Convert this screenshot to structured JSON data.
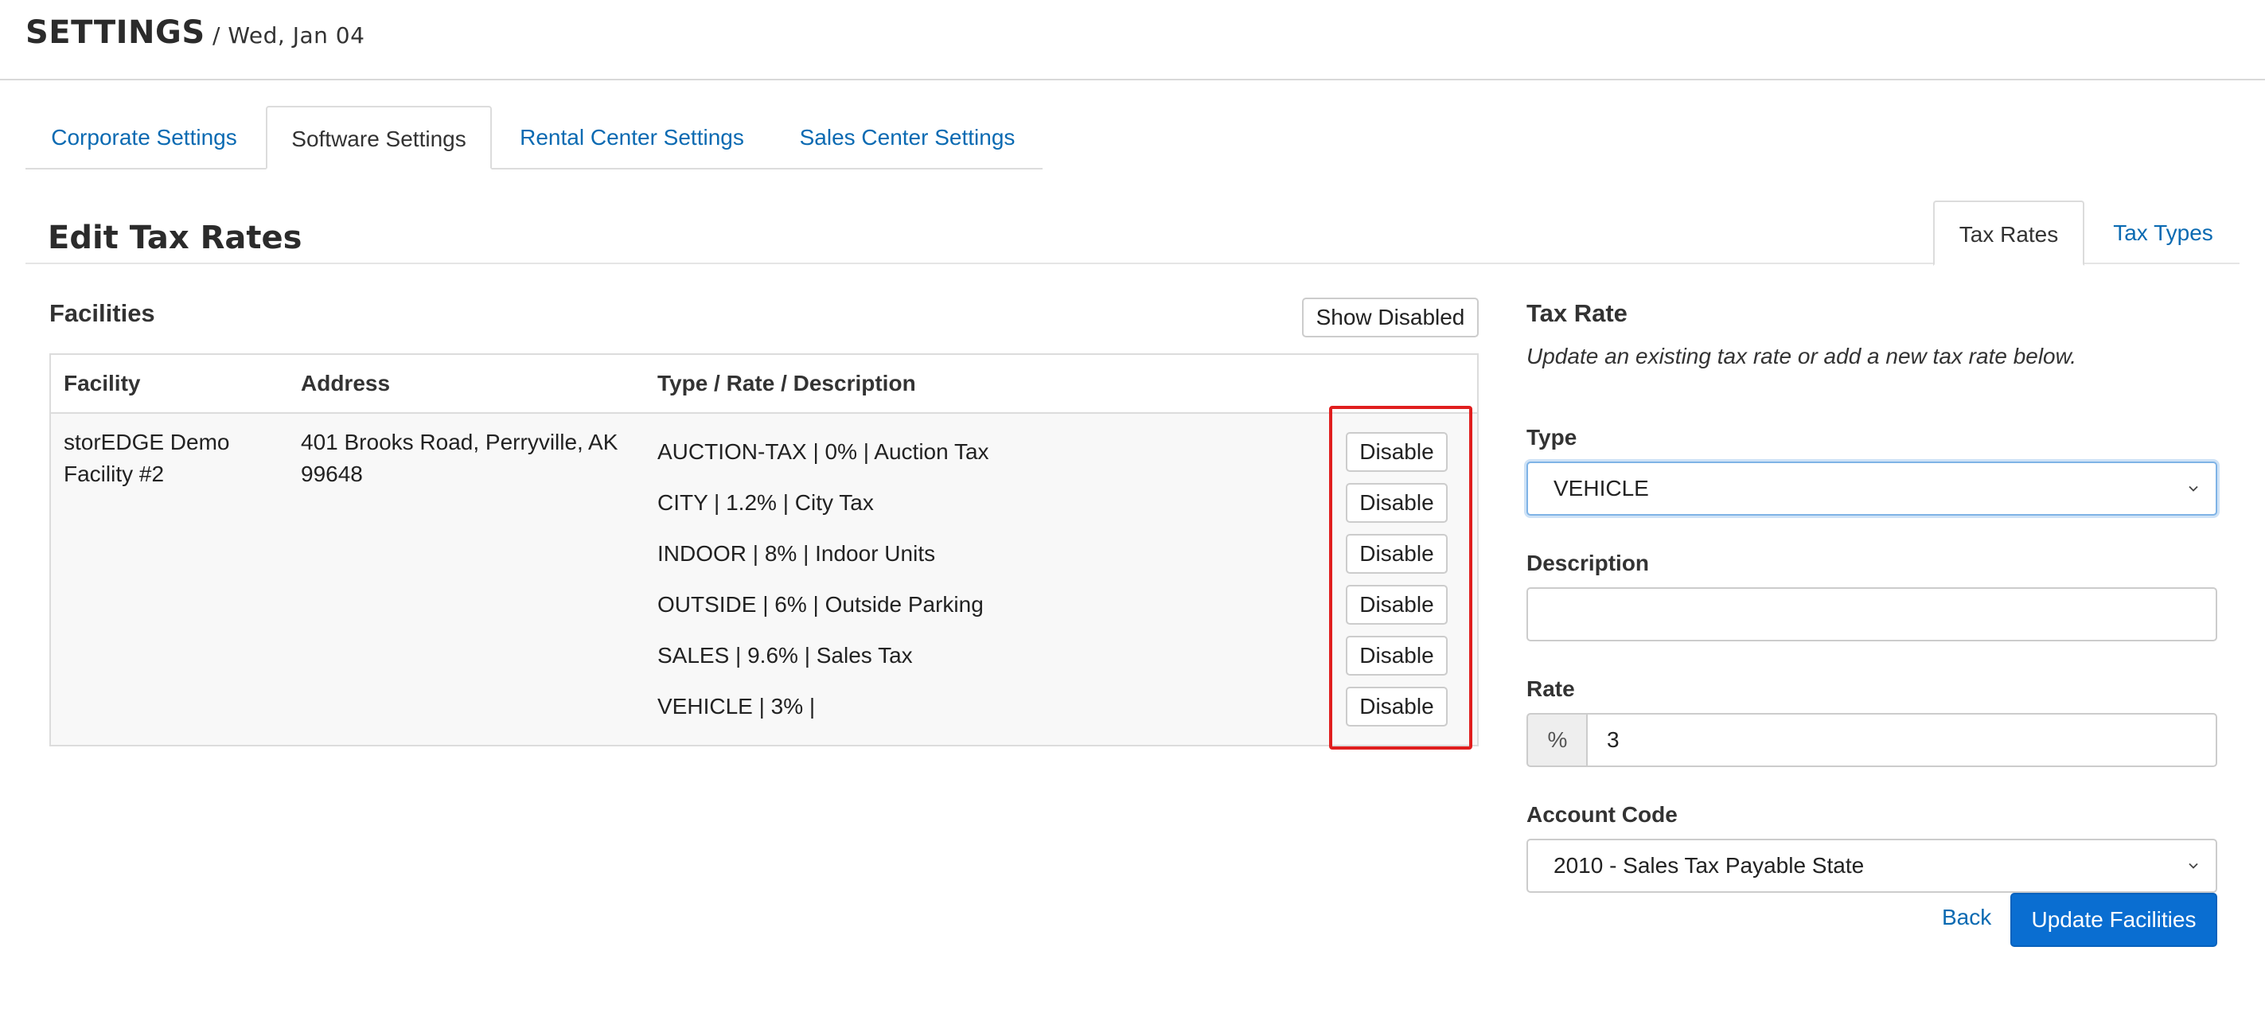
{
  "header": {
    "title": "SETTINGS",
    "date": " / Wed, Jan 04"
  },
  "main_tabs": [
    {
      "label": "Corporate Settings",
      "active": false
    },
    {
      "label": "Software Settings",
      "active": true
    },
    {
      "label": "Rental Center Settings",
      "active": false
    },
    {
      "label": "Sales Center Settings",
      "active": false
    }
  ],
  "section": {
    "title": "Edit Tax Rates"
  },
  "sub_tabs": [
    {
      "label": "Tax Rates",
      "active": true
    },
    {
      "label": "Tax Types",
      "active": false
    }
  ],
  "facilities": {
    "title": "Facilities",
    "show_disabled_label": "Show Disabled",
    "columns": [
      "Facility",
      "Address",
      "Type / Rate / Description"
    ],
    "rows": [
      {
        "facility_line1": "storEDGE Demo",
        "facility_line2": "Facility #2",
        "address_line1": "401 Brooks Road, Perryville, AK",
        "address_line2": "99648",
        "rates": [
          {
            "text": "AUCTION-TAX | 0% | Auction Tax",
            "action": "Disable"
          },
          {
            "text": "CITY | 1.2% | City Tax",
            "action": "Disable"
          },
          {
            "text": "INDOOR | 8% | Indoor Units",
            "action": "Disable"
          },
          {
            "text": "OUTSIDE | 6% | Outside Parking",
            "action": "Disable"
          },
          {
            "text": "SALES | 9.6% | Sales Tax",
            "action": "Disable"
          },
          {
            "text": "VEHICLE | 3% |",
            "action": "Disable"
          }
        ]
      }
    ]
  },
  "tax_rate_form": {
    "title": "Tax Rate",
    "help": "Update an existing tax rate or add a new tax rate below.",
    "type_label": "Type",
    "type_value": "VEHICLE",
    "description_label": "Description",
    "description_value": "",
    "rate_label": "Rate",
    "rate_addon": "%",
    "rate_value": "3",
    "account_code_label": "Account Code",
    "account_code_value": "2010 - Sales Tax Payable State",
    "back_label": "Back",
    "submit_label": "Update Facilities"
  },
  "colors": {
    "link": "#0a6ab2",
    "primary": "#0a6ed1",
    "highlight": "#e01e1e",
    "border": "#dcdcdc"
  }
}
